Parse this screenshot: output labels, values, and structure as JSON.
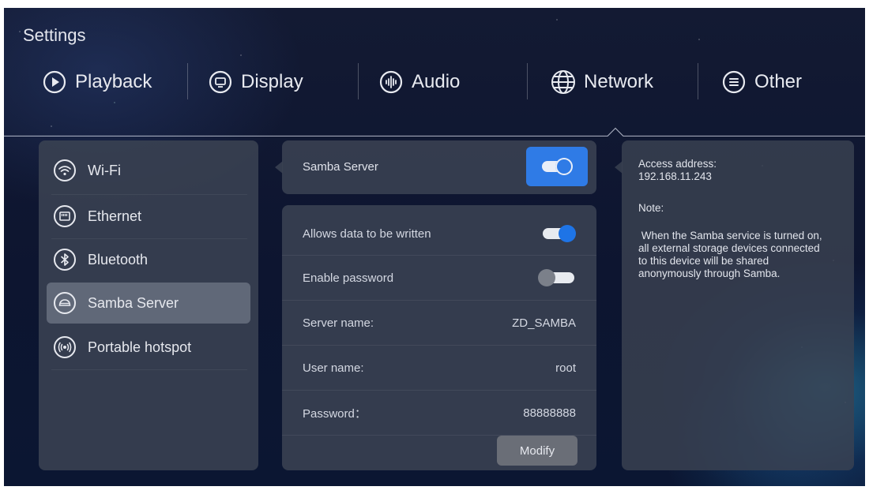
{
  "page": {
    "title": "Settings"
  },
  "tabs": [
    {
      "label": "Playback",
      "icon": "play-circle-icon"
    },
    {
      "label": "Display",
      "icon": "display-icon"
    },
    {
      "label": "Audio",
      "icon": "audio-wave-icon"
    },
    {
      "label": "Network",
      "icon": "globe-icon",
      "selected": true
    },
    {
      "label": "Other",
      "icon": "menu-circle-icon"
    }
  ],
  "sidebar": {
    "items": [
      {
        "label": "Wi-Fi",
        "icon": "wifi-icon"
      },
      {
        "label": "Ethernet",
        "icon": "ethernet-icon"
      },
      {
        "label": "Bluetooth",
        "icon": "bluetooth-icon"
      },
      {
        "label": "Samba Server",
        "icon": "samba-icon",
        "active": true
      },
      {
        "label": "Portable hotspot",
        "icon": "hotspot-icon"
      }
    ]
  },
  "samba": {
    "header_label": "Samba Server",
    "enabled": true,
    "rows": [
      {
        "label": "Allows data to be written",
        "toggle": true
      },
      {
        "label": "Enable password",
        "toggle": false
      },
      {
        "label": "Server name:",
        "value": "ZD_SAMBA"
      },
      {
        "label": "User name:",
        "value": "root"
      },
      {
        "label": "Password：",
        "value": "88888888"
      }
    ],
    "modify_label": "Modify"
  },
  "info": {
    "access_label": "Access address:",
    "access_value": "192.168.11.243",
    "note_label": "Note:",
    "note_line1": " When the Samba service is turned on,",
    "note_line2": "all external storage devices connected",
    "note_line3": "to this device will be shared",
    "note_line4": "anonymously through Samba."
  },
  "colors": {
    "accent": "#2f7be6",
    "toggle_on": "#1e74e6",
    "toggle_off": "#e8ebf0",
    "panel": "#3a4252"
  }
}
